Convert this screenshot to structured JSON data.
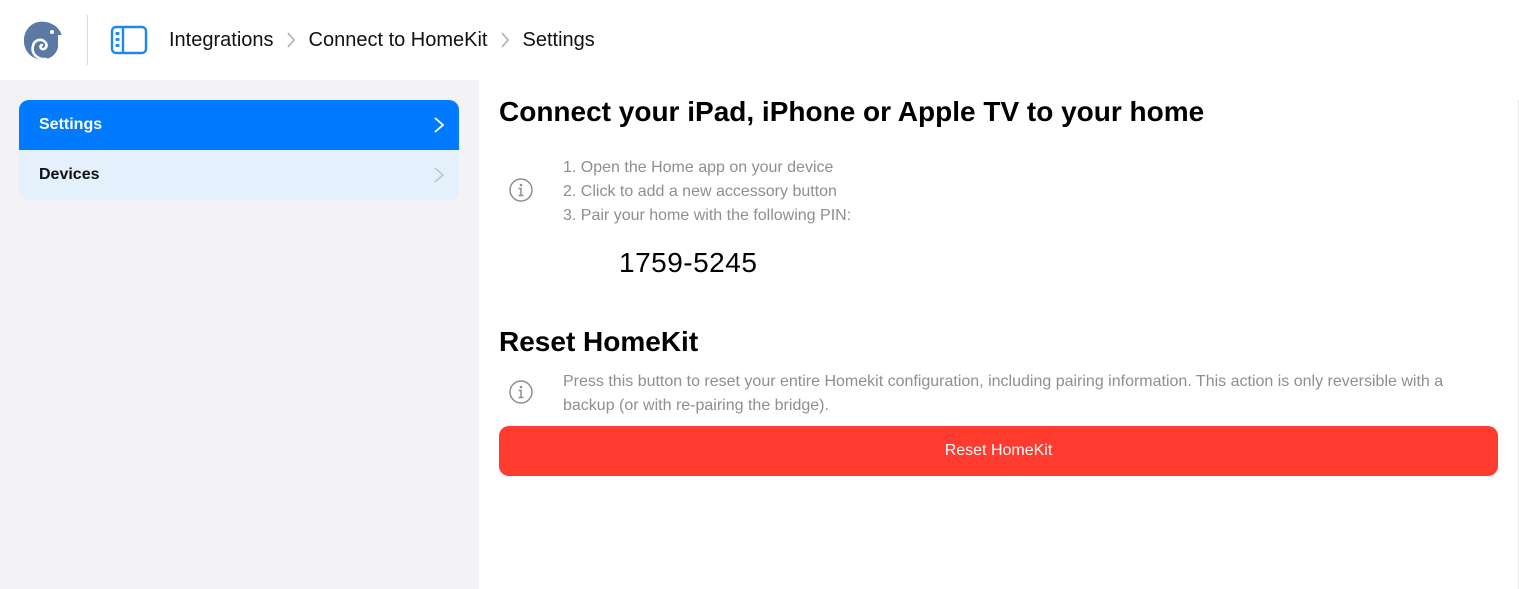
{
  "header": {
    "breadcrumb": [
      {
        "label": "Integrations"
      },
      {
        "label": "Connect to HomeKit"
      },
      {
        "label": "Settings"
      }
    ]
  },
  "sidebar": {
    "items": [
      {
        "label": "Settings",
        "active": true
      },
      {
        "label": "Devices",
        "active": false
      }
    ]
  },
  "main": {
    "connect": {
      "title": "Connect your iPad, iPhone or Apple TV to your home",
      "steps": [
        "1. Open the Home app on your device",
        "2. Click to add a new accessory button",
        "3. Pair your home with the following PIN:"
      ],
      "pin": "1759-5245"
    },
    "reset": {
      "title": "Reset HomeKit",
      "description": "Press this button to reset your entire Homekit configuration, including pairing information. This action is only reversible with a backup (or with re-pairing the bridge).",
      "button_label": "Reset HomeKit"
    }
  },
  "colors": {
    "accent": "#007aff",
    "danger": "#ff3b30",
    "sidebar_bg": "#f2f2f7",
    "inactive_item_bg": "#e5f0fd",
    "muted_text": "#8e8e93"
  },
  "icons": [
    "chameleon-logo-icon",
    "sidebar-toggle-icon",
    "chevron-right-icon",
    "info-icon"
  ]
}
